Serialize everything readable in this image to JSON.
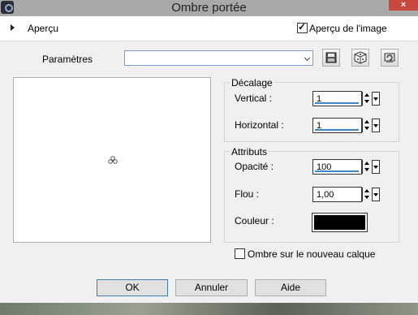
{
  "window": {
    "title": "Ombre portée",
    "close_glyph": "×"
  },
  "preview_section": {
    "label": "Aperçu",
    "image_preview_label": "Aperçu de l'image",
    "image_preview_checked": true
  },
  "presets": {
    "label": "Paramètres",
    "value": ""
  },
  "offset_group": {
    "title": "Décalage",
    "vertical": {
      "label": "Vertical :",
      "value": "1",
      "level": 0.9
    },
    "horizontal": {
      "label": "Horizontal :",
      "value": "1",
      "level": 0.9
    }
  },
  "attributes_group": {
    "title": "Attributs",
    "opacity": {
      "label": "Opacité :",
      "value": "100",
      "level": 0.9
    },
    "blur": {
      "label": "Flou :",
      "value": "1,00"
    },
    "color": {
      "label": "Couleur :",
      "value_hex": "#000000"
    }
  },
  "new_layer": {
    "label": "Ombre sur le nouveau calque",
    "checked": false
  },
  "buttons": {
    "ok": "OK",
    "cancel": "Annuler",
    "help": "Aide"
  },
  "colors": {
    "accent": "#3b86c9",
    "close": "#c9483e"
  }
}
